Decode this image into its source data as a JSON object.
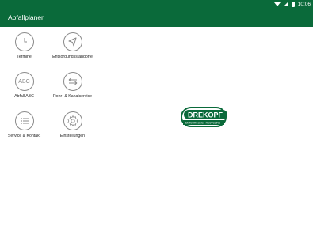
{
  "status": {
    "time": "10:06"
  },
  "app": {
    "title": "Abfallplaner"
  },
  "menu": [
    {
      "label": "Termine",
      "icon": "clock-icon"
    },
    {
      "label": "Entsorgungsstandorte",
      "icon": "navigation-arrow-icon"
    },
    {
      "label": "Abfall ABC",
      "icon": "abc-icon",
      "icon_text": "ABC"
    },
    {
      "label": "Rohr- & Kanalservice",
      "icon": "swap-arrows-icon"
    },
    {
      "label": "Service & Kontakt",
      "icon": "list-icon"
    },
    {
      "label": "Einstellungen",
      "icon": "gear-icon"
    }
  ],
  "logo": {
    "brand": "DREKOPF",
    "tagline": "ENTSORGUNG · RECYCLING"
  },
  "colors": {
    "primary": "#0a6a3a",
    "icon": "#8a8a8a"
  }
}
